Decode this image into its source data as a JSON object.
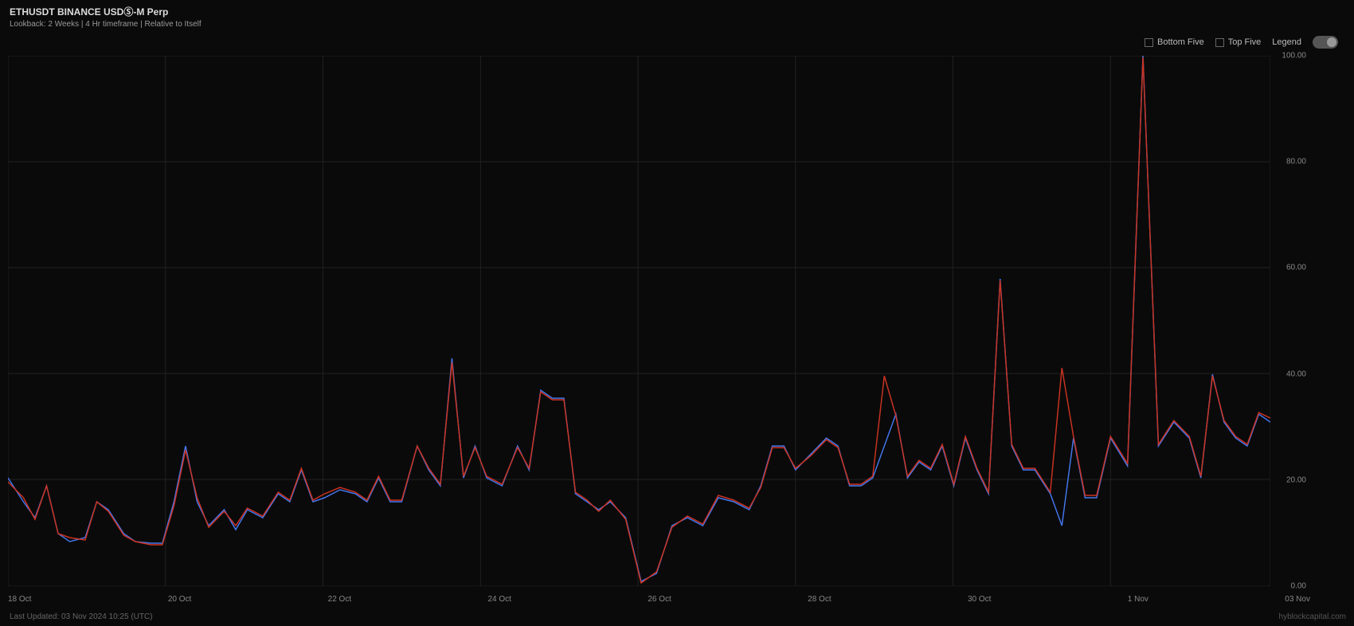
{
  "header": {
    "title": "ETHUSDT BINANCE USDⓈ-M Perp",
    "subtitle": "Lookback: 2 Weeks | 4 Hr timeframe | Relative to Itself"
  },
  "legend": {
    "bottom_five_label": "Bottom Five",
    "top_five_label": "Top Five",
    "legend_label": "Legend"
  },
  "footer": {
    "last_updated": "Last Updated: 03 Nov 2024 10:25 (UTC)",
    "watermark": "hyblockcapital.com"
  },
  "yaxis": {
    "labels": [
      "0.00",
      "20.00",
      "40.00",
      "60.00",
      "80.00",
      "100.00"
    ]
  },
  "xaxis": {
    "labels": [
      "18 Oct",
      "20 Oct",
      "22 Oct",
      "24 Oct",
      "26 Oct",
      "28 Oct",
      "30 Oct",
      "1 Nov",
      "03 Nov"
    ]
  },
  "chart": {
    "blue_line_color": "#4477dd",
    "red_line_color": "#cc3322"
  }
}
